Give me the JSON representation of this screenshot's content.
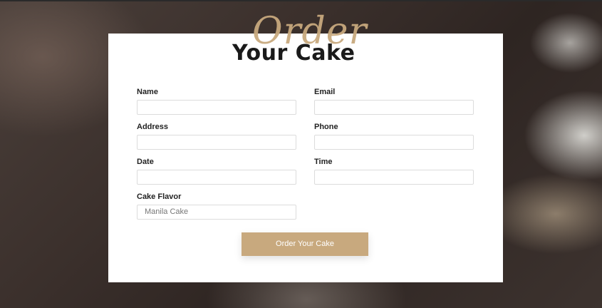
{
  "header": {
    "script_word": "Order",
    "main_title": "Your Cake"
  },
  "form": {
    "fields": [
      {
        "label": "Name",
        "value": ""
      },
      {
        "label": "Email",
        "value": ""
      },
      {
        "label": "Address",
        "value": ""
      },
      {
        "label": "Phone",
        "value": ""
      },
      {
        "label": "Date",
        "value": ""
      },
      {
        "label": "Time",
        "value": ""
      },
      {
        "label": "Cake Flavor",
        "value": "Manila Cake"
      }
    ],
    "submit_label": "Order Your Cake"
  },
  "colors": {
    "accent": "#c8a97e",
    "card_background": "#ffffff",
    "title_text": "#1a1a1a"
  }
}
